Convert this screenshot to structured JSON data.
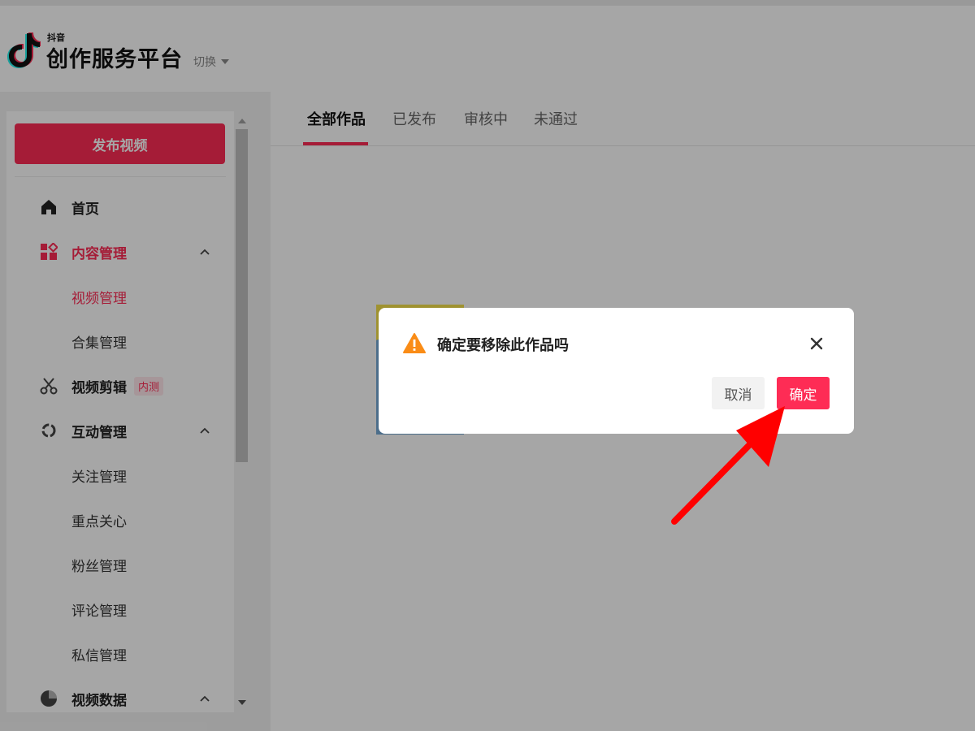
{
  "header": {
    "logo_small": "抖音",
    "logo_title": "创作服务平台",
    "switch_label": "切换"
  },
  "sidebar": {
    "publish_button": "发布视频",
    "items": [
      {
        "label": "首页",
        "icon": "home-icon"
      },
      {
        "label": "内容管理",
        "icon": "content-icon"
      },
      {
        "label": "视频管理"
      },
      {
        "label": "合集管理"
      },
      {
        "label": "视频剪辑",
        "icon": "scissors-icon",
        "badge": "内测"
      },
      {
        "label": "互动管理",
        "icon": "interaction-icon"
      },
      {
        "label": "关注管理"
      },
      {
        "label": "重点关心"
      },
      {
        "label": "粉丝管理"
      },
      {
        "label": "评论管理"
      },
      {
        "label": "私信管理"
      },
      {
        "label": "视频数据",
        "icon": "pie-chart-icon"
      }
    ]
  },
  "tabs": [
    {
      "label": "全部作品"
    },
    {
      "label": "已发布"
    },
    {
      "label": "审核中"
    },
    {
      "label": "未通过"
    }
  ],
  "dialog": {
    "title": "确定要移除此作品吗",
    "cancel": "取消",
    "confirm": "确定",
    "icon": "warning-icon"
  },
  "colors": {
    "accent": "#fe2c55",
    "warning": "#fa8c16",
    "annotation_arrow": "#ff0000"
  }
}
